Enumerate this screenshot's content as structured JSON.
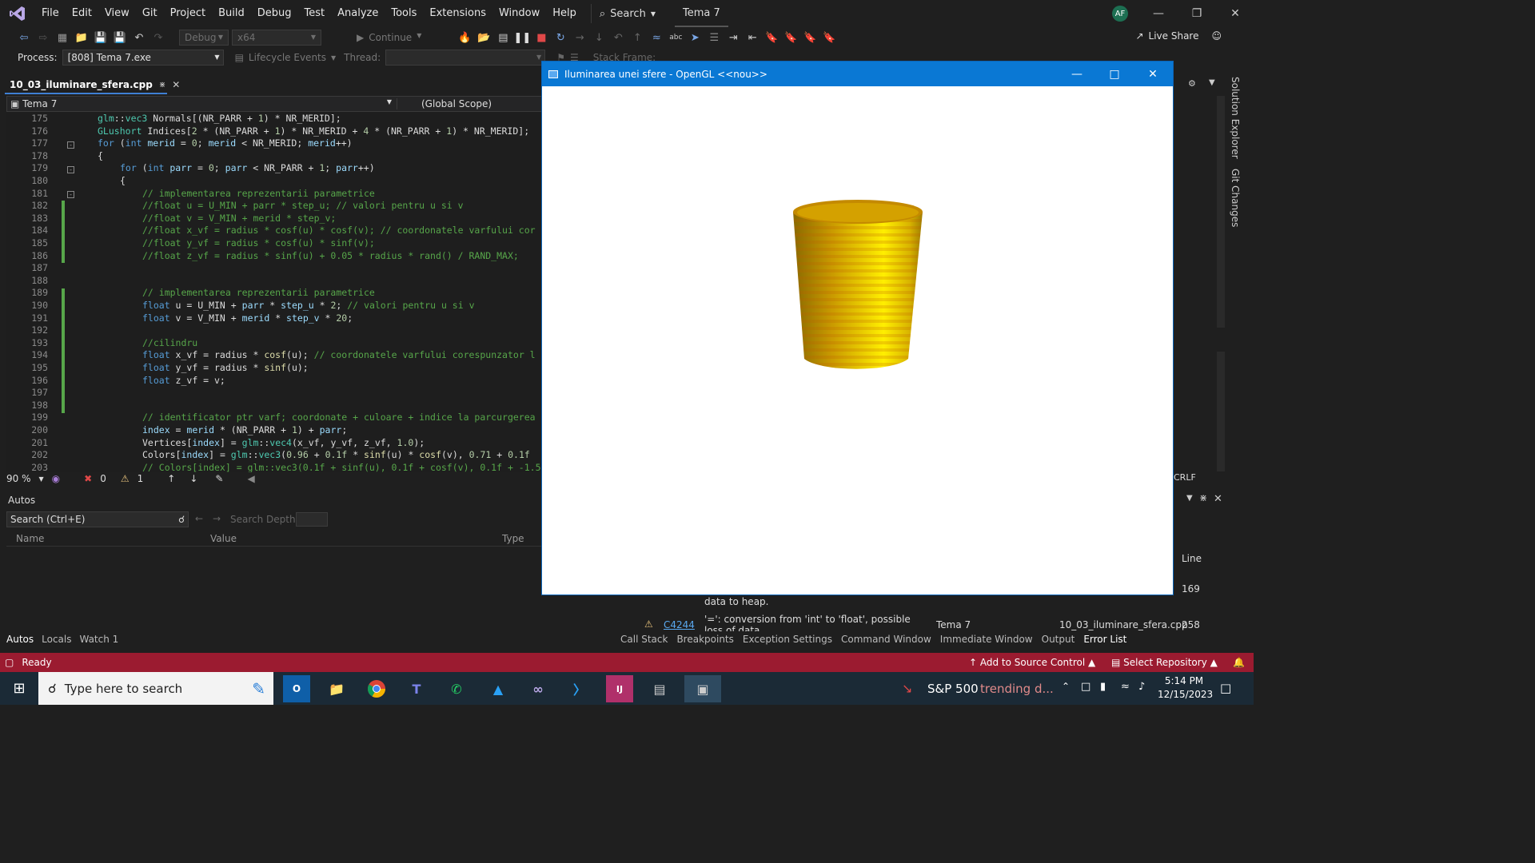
{
  "menubar": {
    "items": [
      "File",
      "Edit",
      "View",
      "Git",
      "Project",
      "Build",
      "Debug",
      "Test",
      "Analyze",
      "Tools",
      "Extensions",
      "Window",
      "Help"
    ],
    "search_label": "Search",
    "solution_title": "Tema 7",
    "avatar_initials": "AF",
    "live_share": "Live Share"
  },
  "toolbar": {
    "config": "Debug",
    "platform": "x64",
    "continue_label": "Continue"
  },
  "process": {
    "label": "Process:",
    "value": "[808] Tema 7.exe",
    "lifecycle": "Lifecycle Events",
    "thread_label": "Thread:",
    "stack_frame": "Stack Frame:"
  },
  "editor": {
    "tab_name": "10_03_iluminare_sfera.cpp",
    "project_scope": "Tema 7",
    "global_scope": "(Global Scope)",
    "zoom": "90 %",
    "errors": "0",
    "warnings": "1",
    "line_ending": "CRLF",
    "lines": [
      {
        "n": "175",
        "indent": 0,
        "text": "glm::vec3 Normals[(NR_PARR + 1) * NR_MERID];"
      },
      {
        "n": "176",
        "indent": 0,
        "text": "GLushort Indices[2 * (NR_PARR + 1) * NR_MERID + 4 * (NR_PARR + 1) * NR_MERID];"
      },
      {
        "n": "177",
        "indent": 0,
        "text": "for (int merid = 0; merid < NR_MERID; merid++)"
      },
      {
        "n": "178",
        "indent": 0,
        "text": "{"
      },
      {
        "n": "179",
        "indent": 1,
        "text": "for (int parr = 0; parr < NR_PARR + 1; parr++)"
      },
      {
        "n": "180",
        "indent": 1,
        "text": "{"
      },
      {
        "n": "181",
        "indent": 2,
        "text": "// implementarea reprezentarii parametrice"
      },
      {
        "n": "182",
        "indent": 2,
        "text": "//float u = U_MIN + parr * step_u; // valori pentru u si v"
      },
      {
        "n": "183",
        "indent": 2,
        "text": "//float v = V_MIN + merid * step_v;"
      },
      {
        "n": "184",
        "indent": 2,
        "text": "//float x_vf = radius * cosf(u) * cosf(v); // coordonatele varfului cor"
      },
      {
        "n": "185",
        "indent": 2,
        "text": "//float y_vf = radius * cosf(u) * sinf(v);"
      },
      {
        "n": "186",
        "indent": 2,
        "text": "//float z_vf = radius * sinf(u) + 0.05 * radius * rand() / RAND_MAX;"
      },
      {
        "n": "187",
        "indent": 2,
        "text": ""
      },
      {
        "n": "188",
        "indent": 2,
        "text": ""
      },
      {
        "n": "189",
        "indent": 2,
        "text": "// implementarea reprezentarii parametrice"
      },
      {
        "n": "190",
        "indent": 2,
        "text": "float u = U_MIN + parr * step_u * 2; // valori pentru u si v"
      },
      {
        "n": "191",
        "indent": 2,
        "text": "float v = V_MIN + merid * step_v * 20;"
      },
      {
        "n": "192",
        "indent": 2,
        "text": ""
      },
      {
        "n": "193",
        "indent": 2,
        "text": "//cilindru"
      },
      {
        "n": "194",
        "indent": 2,
        "text": "float x_vf = radius * cosf(u); // coordonatele varfului corespunzator l"
      },
      {
        "n": "195",
        "indent": 2,
        "text": "float y_vf = radius * sinf(u);"
      },
      {
        "n": "196",
        "indent": 2,
        "text": "float z_vf = v;"
      },
      {
        "n": "197",
        "indent": 2,
        "text": ""
      },
      {
        "n": "198",
        "indent": 2,
        "text": ""
      },
      {
        "n": "199",
        "indent": 2,
        "text": "// identificator ptr varf; coordonate + culoare + indice la parcurgerea"
      },
      {
        "n": "200",
        "indent": 2,
        "text": "index = merid * (NR_PARR + 1) + parr;"
      },
      {
        "n": "201",
        "indent": 2,
        "text": "Vertices[index] = glm::vec4(x_vf, y_vf, z_vf, 1.0);"
      },
      {
        "n": "202",
        "indent": 2,
        "text": "Colors[index] = glm::vec3(0.96 + 0.1f * sinf(u) * cosf(v), 0.71 + 0.1f"
      },
      {
        "n": "203",
        "indent": 2,
        "text": "// Colors[index] = glm::vec3(0.1f + sinf(u), 0.1f + cosf(v), 0.1f + -1.5"
      }
    ]
  },
  "autos": {
    "title": "Autos",
    "search_placeholder": "Search (Ctrl+E)",
    "search_depth": "Search Depth:",
    "col_name": "Name",
    "col_value": "Value",
    "col_type": "Type"
  },
  "bottom_tabs_left": [
    "Autos",
    "Locals",
    "Watch 1"
  ],
  "bottom_tabs_right": [
    "Call Stack",
    "Breakpoints",
    "Exception Settings",
    "Command Window",
    "Immediate Window",
    "Output",
    "Error List"
  ],
  "errorlist": {
    "prev_desc": "data to heap.",
    "code": "C4244",
    "desc": "'=': conversion from 'int' to 'float', possible loss of data",
    "project": "Tema 7",
    "file": "10_03_iluminare_sfera.cpp",
    "line": "258",
    "line_header": "Line",
    "line_prev": "169"
  },
  "statusbar": {
    "ready": "Ready",
    "source_control": "Add to Source Control",
    "repo": "Select Repository"
  },
  "taskbar": {
    "search_placeholder": "Type here to search",
    "stock": "S&P 500",
    "stock_status": "trending d...",
    "time": "5:14 PM",
    "date": "12/15/2023"
  },
  "glwindow": {
    "title": "Iluminarea unei sfere - OpenGL <<nou>>"
  },
  "side_panels": [
    "Solution Explorer",
    "Git Changes"
  ],
  "colors": {
    "accent": "#0a78d4",
    "statusbar": "#9b1b30",
    "taskbar": "#1b2a36"
  }
}
